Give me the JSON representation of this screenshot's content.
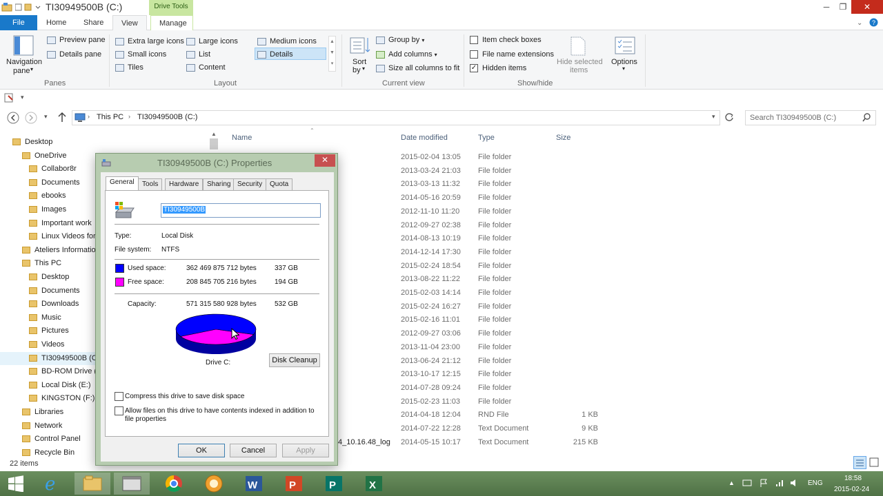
{
  "window": {
    "title": "TI30949500B (C:)",
    "context_tab": "Drive Tools",
    "minimize": "─",
    "restore": "❐",
    "close": "✕"
  },
  "ribbon_tabs": [
    "File",
    "Home",
    "Share",
    "View",
    "Manage"
  ],
  "ribbon": {
    "panes": {
      "navigation_pane": "Navigation",
      "navigation_pane_2": "pane",
      "preview_pane": "Preview pane",
      "details_pane": "Details pane",
      "label": "Panes"
    },
    "layout": {
      "items": [
        "Extra large icons",
        "Large icons",
        "Medium icons",
        "Small icons",
        "List",
        "Details",
        "Tiles",
        "Content"
      ],
      "label": "Layout"
    },
    "current_view": {
      "sort_by": "Sort",
      "sort_by_2": "by",
      "group_by": "Group by",
      "add_columns": "Add columns",
      "size_all_columns": "Size all columns to fit",
      "label": "Current view"
    },
    "show_hide": {
      "item_check_boxes": "Item check boxes",
      "file_name_extensions": "File name extensions",
      "hidden_items": "Hidden items",
      "hide_selected": "Hide selected",
      "hide_selected_2": "items",
      "options": "Options",
      "label": "Show/hide"
    }
  },
  "address": {
    "crumbs": [
      "This PC",
      "TI30949500B (C:)"
    ],
    "search_placeholder": "Search TI30949500B (C:)"
  },
  "nav": [
    {
      "label": "Desktop"
    },
    {
      "label": "OneDrive"
    },
    {
      "label": "Collabor8r"
    },
    {
      "label": "Documents"
    },
    {
      "label": "ebooks"
    },
    {
      "label": "Images"
    },
    {
      "label": "Important work"
    },
    {
      "label": "Linux Videos for"
    },
    {
      "label": "Ateliers Informatio"
    },
    {
      "label": "This PC"
    },
    {
      "label": "Desktop"
    },
    {
      "label": "Documents"
    },
    {
      "label": "Downloads"
    },
    {
      "label": "Music"
    },
    {
      "label": "Pictures"
    },
    {
      "label": "Videos"
    },
    {
      "label": "TI30949500B (C:)"
    },
    {
      "label": "BD-ROM Drive (D"
    },
    {
      "label": "Local Disk (E:)"
    },
    {
      "label": "KINGSTON (F:)"
    },
    {
      "label": "Libraries"
    },
    {
      "label": "Network"
    },
    {
      "label": "Control Panel"
    },
    {
      "label": "Recycle Bin"
    }
  ],
  "columns": {
    "name": "Name",
    "date": "Date modified",
    "type": "Type",
    "size": "Size"
  },
  "files": [
    {
      "name": "",
      "date": "2015-02-04 13:05",
      "type": "File folder",
      "size": ""
    },
    {
      "name": "",
      "date": "2013-03-24 21:03",
      "type": "File folder",
      "size": ""
    },
    {
      "name": "",
      "date": "2013-03-13 11:32",
      "type": "File folder",
      "size": ""
    },
    {
      "name": "",
      "date": "2014-05-16 20:59",
      "type": "File folder",
      "size": ""
    },
    {
      "name": "",
      "date": "2012-11-10 11:20",
      "type": "File folder",
      "size": ""
    },
    {
      "name": "",
      "date": "2012-09-27 02:38",
      "type": "File folder",
      "size": ""
    },
    {
      "name": "",
      "date": "2014-08-13 10:19",
      "type": "File folder",
      "size": ""
    },
    {
      "name": "",
      "date": "2014-12-14 17:30",
      "type": "File folder",
      "size": ""
    },
    {
      "name": "",
      "date": "2015-02-24 18:54",
      "type": "File folder",
      "size": ""
    },
    {
      "name": "",
      "date": "2013-08-22 11:22",
      "type": "File folder",
      "size": ""
    },
    {
      "name": "",
      "date": "2015-02-03 14:14",
      "type": "File folder",
      "size": ""
    },
    {
      "name": "",
      "date": "2015-02-24 16:27",
      "type": "File folder",
      "size": ""
    },
    {
      "name": "",
      "date": "2015-02-16 11:01",
      "type": "File folder",
      "size": ""
    },
    {
      "name": "",
      "date": "2012-09-27 03:06",
      "type": "File folder",
      "size": ""
    },
    {
      "name": "",
      "date": "2013-11-04 23:00",
      "type": "File folder",
      "size": ""
    },
    {
      "name": "",
      "date": "2013-06-24 21:12",
      "type": "File folder",
      "size": ""
    },
    {
      "name": "",
      "date": "2013-10-17 12:15",
      "type": "File folder",
      "size": ""
    },
    {
      "name": "",
      "date": "2014-07-28 09:24",
      "type": "File folder",
      "size": ""
    },
    {
      "name": "",
      "date": "2015-02-23 11:03",
      "type": "File folder",
      "size": ""
    },
    {
      "name": "",
      "date": "2014-04-18 12:04",
      "type": "RND File",
      "size": "1 KB"
    },
    {
      "name": "",
      "date": "2014-07-22 12:28",
      "type": "Text Document",
      "size": "9 KB"
    },
    {
      "name": "4_10.16.48_log",
      "date": "2014-05-15 10:17",
      "type": "Text Document",
      "size": "215 KB"
    }
  ],
  "status": {
    "items": "22 items"
  },
  "dialog": {
    "title": "TI30949500B (C:) Properties",
    "close": "✕",
    "tabs": [
      "General",
      "Tools",
      "Hardware",
      "Sharing",
      "Security",
      "Quota"
    ],
    "volume_label": "TI30949500B",
    "type_label": "Type:",
    "type_value": "Local Disk",
    "fs_label": "File system:",
    "fs_value": "NTFS",
    "used_label": "Used space:",
    "used_bytes": "362 469 875 712 bytes",
    "used_gb": "337 GB",
    "free_label": "Free space:",
    "free_bytes": "208 845 705 216 bytes",
    "free_gb": "194 GB",
    "capacity_label": "Capacity:",
    "capacity_bytes": "571 315 580 928 bytes",
    "capacity_gb": "532 GB",
    "drive_label": "Drive C:",
    "disk_cleanup": "Disk Cleanup",
    "compress_label": "Compress this drive to save disk space",
    "index_label_1": "Allow files on this drive to have contents indexed in addition to",
    "index_label_2": "file properties",
    "ok": "OK",
    "cancel": "Cancel",
    "apply": "Apply",
    "used_fraction": 0.634,
    "used_color": "#0000ff",
    "free_color": "#ff00ff"
  },
  "taskbar": {
    "lang": "ENG",
    "time": "18:58",
    "date": "2015-02-24"
  }
}
